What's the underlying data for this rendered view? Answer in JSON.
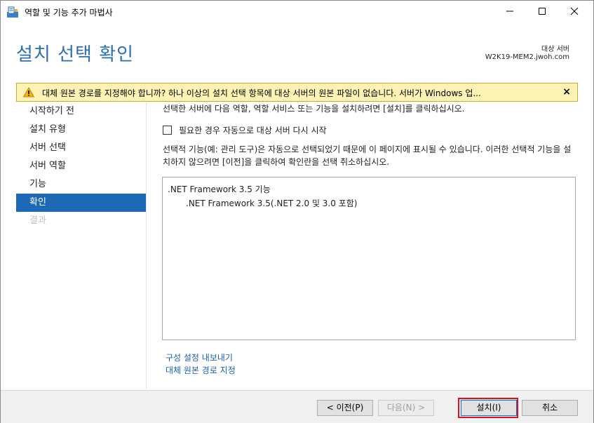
{
  "window": {
    "title": "역할 및 기능 추가 마법사",
    "icons": {
      "app": "server-manager-icon",
      "minimize": "minimize-icon",
      "maximize": "maximize-icon",
      "close": "close-icon"
    }
  },
  "header": {
    "page_title": "설치 선택 확인",
    "destination_label": "대상 서버",
    "destination_server": "W2K19-MEM2.jwoh.com"
  },
  "warning": {
    "text": "대체 원본 경로를 지정해야 합니까? 하나 이상의 설치 선택 항목에 대상 서버의 원본 파일이 없습니다. 서버가 Windows 업...",
    "close_label": "×",
    "icon": "warning-icon"
  },
  "nav": {
    "items": [
      {
        "label": "시작하기 전",
        "state": "normal"
      },
      {
        "label": "설치 유형",
        "state": "normal"
      },
      {
        "label": "서버 선택",
        "state": "normal"
      },
      {
        "label": "서버 역할",
        "state": "normal"
      },
      {
        "label": "기능",
        "state": "normal"
      },
      {
        "label": "확인",
        "state": "active"
      },
      {
        "label": "결과",
        "state": "disabled"
      }
    ]
  },
  "content": {
    "intro": "선택한 서버에 다음 역할, 역할 서비스 또는 기능을 설치하려면 [설치]를 클릭하십시오.",
    "restart_label": "필요한 경우 자동으로 대상 서버 다시 시작",
    "restart_checked": false,
    "optional_text": "선택적 기능(예: 관리 도구)은 자동으로 선택되었기 때문에 이 페이지에 표시될 수 있습니다. 이러한 선택적 기능을 설치하지 않으려면 [이전]을 클릭하여 확인란을 선택 취소하십시오.",
    "list": [
      {
        "label": ".NET Framework 3.5 기능",
        "indent": 0
      },
      {
        "label": ".NET Framework 3.5(.NET 2.0 및 3.0 포함)",
        "indent": 1
      }
    ],
    "links": {
      "export": "구성 설정 내보내기",
      "alt_source": "대체 원본 경로 지정"
    }
  },
  "footer": {
    "prev": "< 이전(P)",
    "next": "다음(N) >",
    "install": "설치(I)",
    "cancel": "취소"
  },
  "colors": {
    "title_blue": "#2c6fb0",
    "nav_active": "#1e69b5",
    "warning_bg": "#fcf2b4",
    "highlight_red": "#e0101a"
  }
}
